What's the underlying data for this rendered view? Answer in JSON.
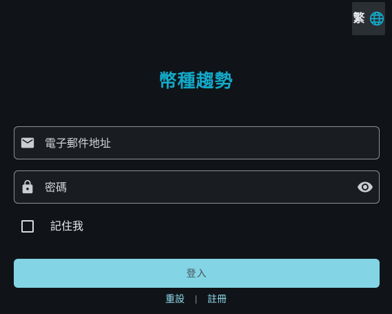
{
  "header": {
    "language_label": "繁",
    "language_icon": "globe-icon"
  },
  "app": {
    "title": "幣種趨勢"
  },
  "form": {
    "email": {
      "icon": "mail-icon",
      "placeholder": "電子郵件地址",
      "value": ""
    },
    "password": {
      "icon": "lock-icon",
      "placeholder": "密碼",
      "value": "",
      "toggle_icon": "eye-icon"
    },
    "remember_me": {
      "label": "記住我",
      "checked": false
    },
    "login_label": "登入"
  },
  "footer": {
    "reset_label": "重設",
    "register_label": "註冊"
  },
  "colors": {
    "background": "#101418",
    "accent": "#13a9c9",
    "button": "#83d4e4",
    "link": "#8fd8ea"
  }
}
